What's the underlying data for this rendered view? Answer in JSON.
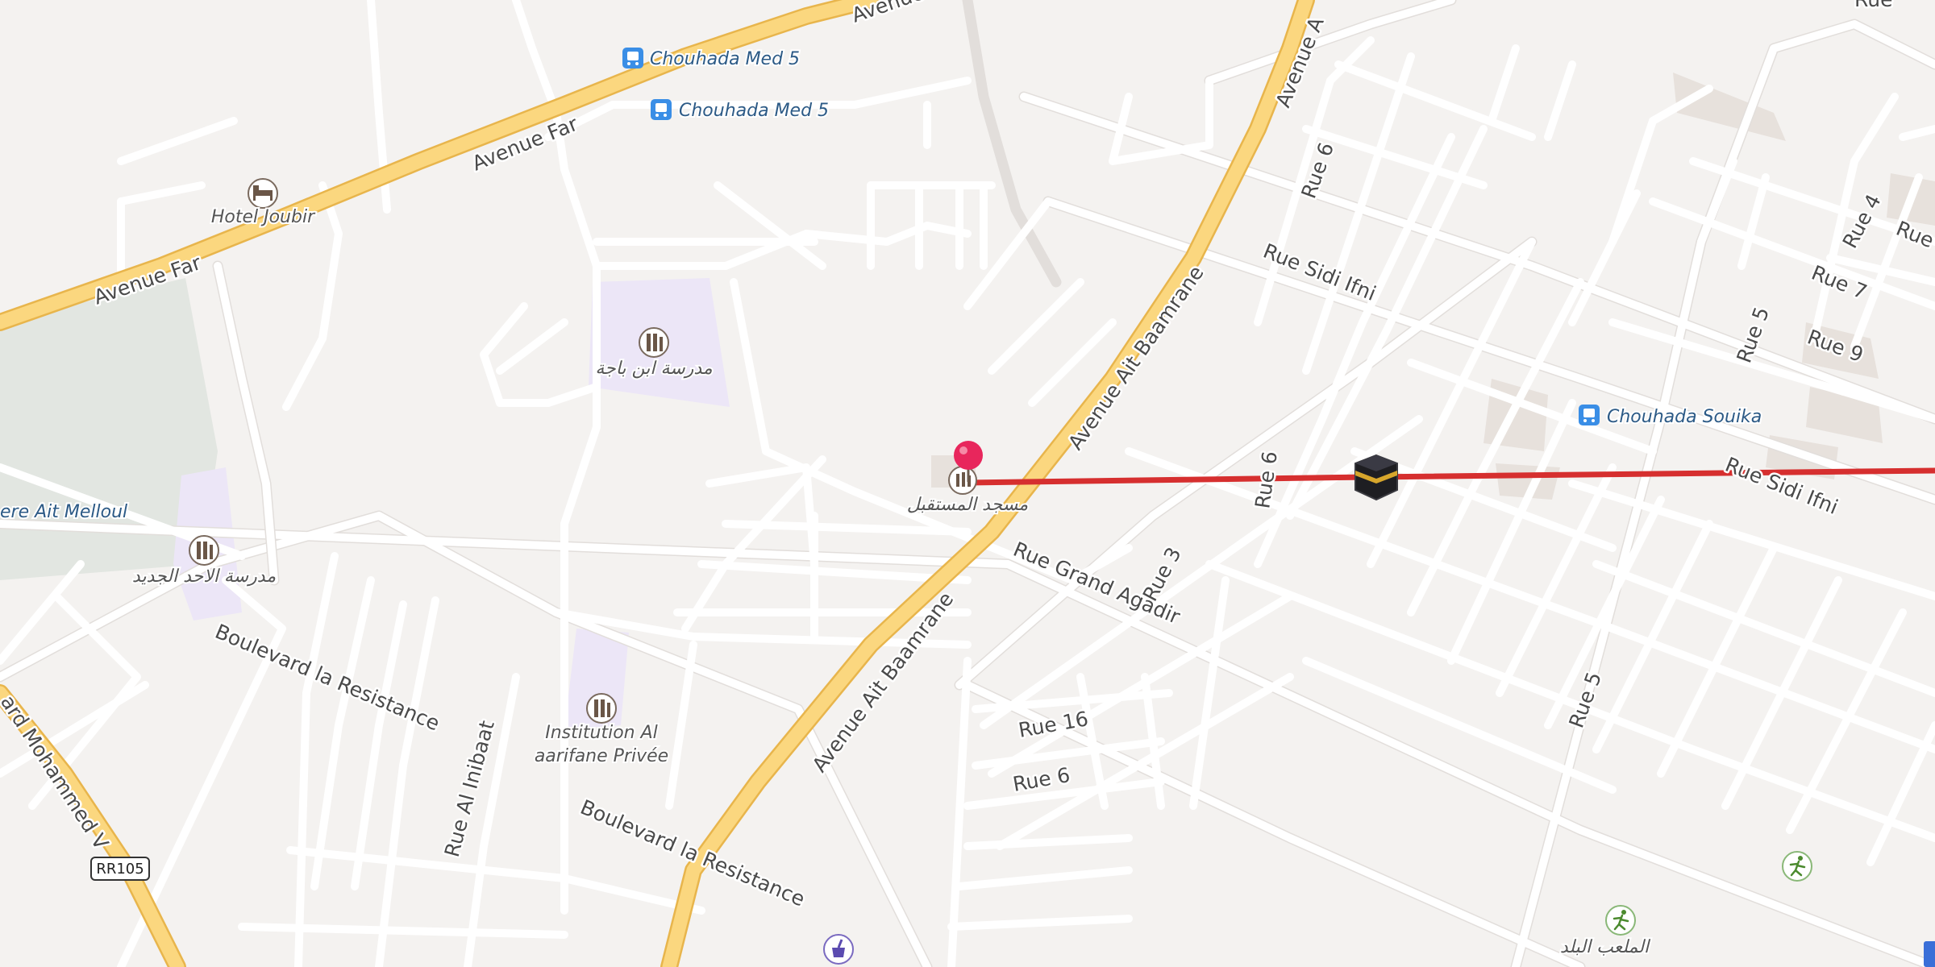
{
  "map": {
    "roads": {
      "avenue_far": "Avenue Far",
      "avenue_far_2": "Avenue Far",
      "avenue_far_top": "Avenue",
      "avenue_ait_baamrane": "Avenue Ait Baamrane",
      "avenue_ait_baamrane_2": "Avenue Ait Baamrane",
      "avenue_ait_top": "Avenue A",
      "rue_grand_agadir": "Rue Grand Agadir",
      "boulevard_resistance": "Boulevard la Resistance",
      "boulevard_resistance_2": "Boulevard la Resistance",
      "rue_al_inibaat": "Rue Al Inibaat",
      "boulevard_mohammed_v": "ard Mohammed V",
      "rue_sidi_ifni": "Rue Sidi Ifni",
      "rue_sidi_ifni_2": "Rue Sidi Ifni",
      "rue_6_a": "Rue 6",
      "rue_6_b": "Rue 6",
      "rue_6_c": "Rue 6",
      "rue_3": "Rue 3",
      "rue_16": "Rue 16",
      "rue_5_a": "Rue 5",
      "rue_5_b": "Rue 5",
      "rue_4": "Rue 4",
      "rue_7": "Rue 7",
      "rue_9": "Rue 9",
      "rue_top_right": "Rue",
      "rue_right": "Rue",
      "route_shield": "RR105"
    },
    "pois": {
      "bus_stop_1": "Chouhada Med 5",
      "bus_stop_2": "Chouhada Med 5",
      "bus_stop_3": "Chouhada Souika",
      "hotel": "Hotel Joubir",
      "school_ibn_baja": "مدرسة ابن باجة",
      "school_al_ahad": "مدرسة الاحد الجديد",
      "institution_line1": "Institution Al",
      "institution_line2": "aarifane Privée",
      "mosque": "مسجد المستقبل",
      "area_ait_melloul": "ere Ait Melloul",
      "stadium": "الملعب البلد"
    },
    "colors": {
      "route_line": "#d62f2f",
      "marker_pin": "#e8265c",
      "major_road": "#fbd77f",
      "school_area": "#ece6f7",
      "park_area": "#e2e6e1",
      "bus_icon": "#3a8ee6"
    },
    "icons": [
      "bus-stop-icon",
      "hotel-icon",
      "school-icon",
      "mosque-icon",
      "kaaba-icon",
      "location-pin-icon",
      "sports-icon",
      "pharmacy-icon"
    ]
  }
}
